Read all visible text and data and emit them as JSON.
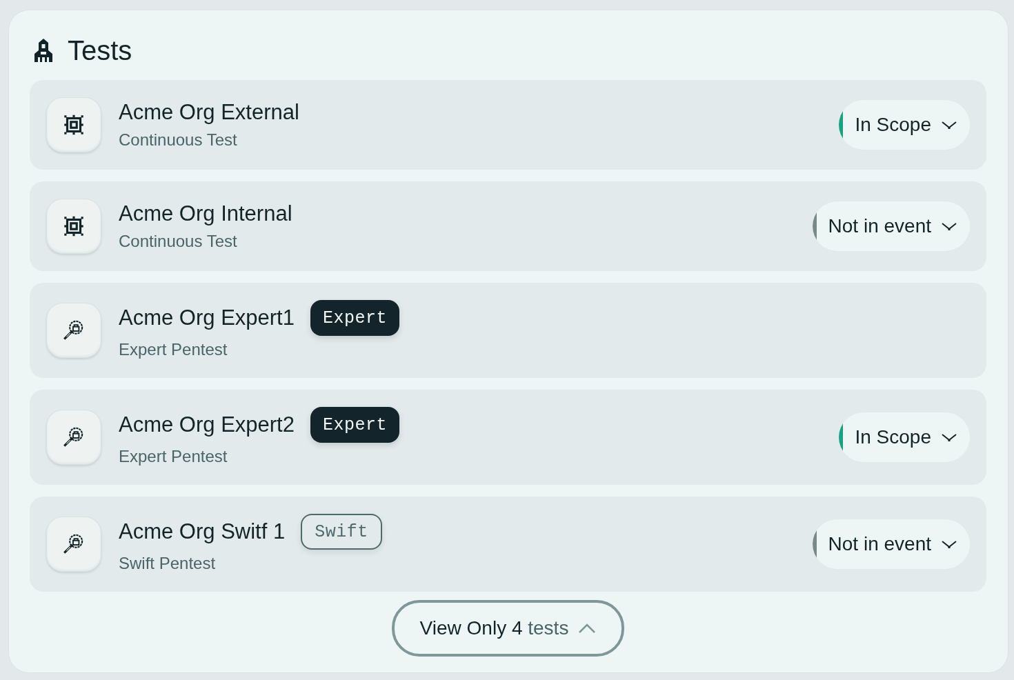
{
  "header": {
    "title": "Tests"
  },
  "tests": [
    {
      "kind": "continuous",
      "name": "Acme Org External",
      "type": "Continuous Test",
      "status": {
        "label": "In Scope",
        "color": "#14a383"
      }
    },
    {
      "kind": "continuous",
      "name": "Acme Org Internal",
      "type": "Continuous Test",
      "status": {
        "label": "Not in event",
        "color": "#778a8a"
      }
    },
    {
      "kind": "pentest",
      "name": "Acme Org Expert1",
      "badge": {
        "label": "Expert",
        "kind": "filled"
      },
      "type": "Expert Pentest"
    },
    {
      "kind": "pentest",
      "name": "Acme Org Expert2",
      "badge": {
        "label": "Expert",
        "kind": "filled"
      },
      "type": "Expert Pentest",
      "status": {
        "label": "In Scope",
        "color": "#14a383"
      }
    },
    {
      "kind": "pentest",
      "name": "Acme Org Switf 1",
      "badge": {
        "label": "Swift",
        "kind": "outlined"
      },
      "type": "Swift Pentest",
      "status": {
        "label": "Not in event",
        "color": "#778a8a"
      }
    }
  ],
  "view_toggle": {
    "label": "View Only 4",
    "suffix": "tests",
    "expanded": true
  }
}
